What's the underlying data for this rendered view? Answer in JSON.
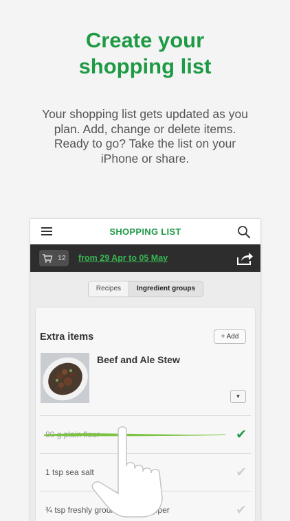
{
  "headline": {
    "line1": "Create your",
    "line2": "shopping list"
  },
  "description": {
    "line1": "Your shopping list gets updated as you",
    "line2": "plan. Add, change or delete items.",
    "line3": "Ready to go? Take the list on your",
    "line4": "iPhone or share."
  },
  "app": {
    "title": "SHOPPING LIST",
    "cart_count": "12",
    "date_range": "from 29 Apr to 05 May",
    "tabs": [
      "Recipes",
      "Ingredient groups"
    ],
    "active_tab": "Ingredient groups",
    "section_title": "Extra items",
    "add_label": "+ Add",
    "recipe_name": "Beef and Ale Stew",
    "items": [
      {
        "text": "80 g plain flour",
        "checked": true
      },
      {
        "text": "1 tsp sea salt",
        "checked": false
      },
      {
        "text": "¾ tsp freshly ground black pepper",
        "checked": false
      }
    ]
  },
  "colors": {
    "accent": "#1e9a45",
    "date_link": "#38b653",
    "strike_brush": "#7cc243",
    "dark_bar": "#2d2d2d"
  },
  "icons": [
    "menu-icon",
    "search-icon",
    "cart-icon",
    "share-icon",
    "checkmark-icon",
    "chevron-down-icon",
    "hand-pointer-icon"
  ]
}
